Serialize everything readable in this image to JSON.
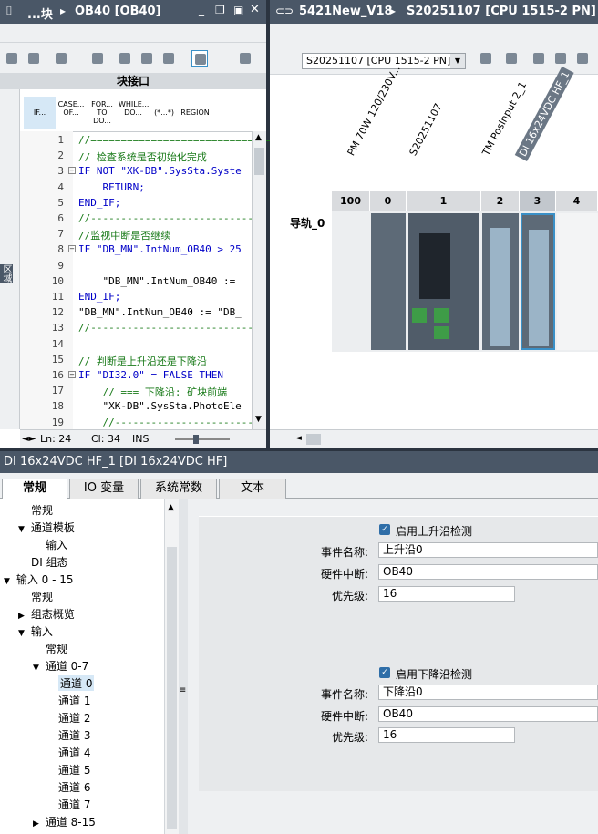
{
  "left_title": "...块",
  "left_breadcrumb": "OB40 [OB40]",
  "right_breadcrumb_project": "5421New_V18",
  "right_breadcrumb_device": "S20251107 [CPU 1515-2 PN]",
  "block_interface": "块接口",
  "instr_tabs": [
    "IF...",
    "CASE... OF...",
    "FOR... TO DO...",
    "WHILE... DO...",
    "(*...*)",
    "REGION"
  ],
  "code_lines": [
    {
      "n": "1",
      "t": "//=================================",
      "c": "cm"
    },
    {
      "n": "2",
      "t": "// 检查系统是否初始化完成",
      "c": "cm"
    },
    {
      "n": "3",
      "t": "IF NOT \"XK-DB\".SysSta.Syste",
      "c": "kw"
    },
    {
      "n": "4",
      "t": "    RETURN;",
      "c": "kw"
    },
    {
      "n": "5",
      "t": "END_IF;",
      "c": "kw"
    },
    {
      "n": "6",
      "t": "//---------------------------",
      "c": "cm"
    },
    {
      "n": "7",
      "t": "//监视中断是否继续",
      "c": "cm"
    },
    {
      "n": "8",
      "t": "IF \"DB_MN\".IntNum_OB40 > 25",
      "c": "kw"
    },
    {
      "n": "9",
      "t": "",
      "c": "str"
    },
    {
      "n": "10",
      "t": "    \"DB_MN\".IntNum_OB40 :=",
      "c": "str"
    },
    {
      "n": "11",
      "t": "END_IF;",
      "c": "kw"
    },
    {
      "n": "12",
      "t": "\"DB_MN\".IntNum_OB40 := \"DB_",
      "c": "str"
    },
    {
      "n": "13",
      "t": "//---------------------------",
      "c": "cm"
    },
    {
      "n": "14",
      "t": "",
      "c": "str"
    },
    {
      "n": "15",
      "t": "// 判断是上升沿还是下降沿",
      "c": "cm"
    },
    {
      "n": "16",
      "t": "IF \"DI32.0\" = FALSE THEN",
      "c": "kw"
    },
    {
      "n": "17",
      "t": "    // === 下降沿: 矿块前端",
      "c": "cm"
    },
    {
      "n": "18",
      "t": "    \"XK-DB\".SysSta.PhotoEle",
      "c": "str"
    },
    {
      "n": "19",
      "t": "    //-----------------------",
      "c": "cm"
    }
  ],
  "status": {
    "ln": "Ln: 24",
    "cl": "Cl: 34",
    "mode": "INS"
  },
  "device_select": "S20251107 [CPU 1515-2 PN]",
  "module_labels": [
    "PM 70W 120/230V...",
    "S20251107",
    "TM PosInput 2_1",
    "DI 16x24VDC HF_1"
  ],
  "rail_label": "导轨_0",
  "slots": [
    "100",
    "0",
    "1",
    "2",
    "3",
    "4"
  ],
  "props_title": "DI 16x24VDC HF_1 [DI 16x24VDC HF]",
  "props_tabs": [
    "常规",
    "IO 变量",
    "系统常数",
    "文本"
  ],
  "tree": [
    {
      "label": "常规",
      "indent": 0,
      "arrow": ""
    },
    {
      "label": "通道模板",
      "indent": 0,
      "arrow": "▼"
    },
    {
      "label": "输入",
      "indent": 2,
      "arrow": ""
    },
    {
      "label": "DI 组态",
      "indent": 0,
      "arrow": ""
    },
    {
      "label": "输入 0 - 15",
      "indent": -1,
      "arrow": "▼"
    },
    {
      "label": "常规",
      "indent": 0,
      "arrow": ""
    },
    {
      "label": "组态概览",
      "indent": 0,
      "arrow": "▶"
    },
    {
      "label": "输入",
      "indent": 0,
      "arrow": "▼"
    },
    {
      "label": "常规",
      "indent": 1,
      "arrow": ""
    },
    {
      "label": "通道 0-7",
      "indent": 1,
      "arrow": "▼"
    },
    {
      "label": "通道 0",
      "indent": 2,
      "arrow": ""
    },
    {
      "label": "通道 1",
      "indent": 2,
      "arrow": ""
    },
    {
      "label": "通道 2",
      "indent": 2,
      "arrow": ""
    },
    {
      "label": "通道 3",
      "indent": 2,
      "arrow": ""
    },
    {
      "label": "通道 4",
      "indent": 2,
      "arrow": ""
    },
    {
      "label": "通道 5",
      "indent": 2,
      "arrow": ""
    },
    {
      "label": "通道 6",
      "indent": 2,
      "arrow": ""
    },
    {
      "label": "通道 7",
      "indent": 2,
      "arrow": ""
    },
    {
      "label": "通道 8-15",
      "indent": 1,
      "arrow": "▶"
    }
  ],
  "rising": {
    "checkbox": "启用上升沿检测",
    "event_label": "事件名称:",
    "event": "上升沿0",
    "hw_label": "硬件中断:",
    "hw": "OB40",
    "prio_label": "优先级:",
    "prio": "16"
  },
  "falling": {
    "checkbox": "启用下降沿检测",
    "event_label": "事件名称:",
    "event": "下降沿0",
    "hw_label": "硬件中断:",
    "hw": "OB40",
    "prio_label": "优先级:",
    "prio": "16"
  },
  "side_label": "区域",
  "colors": {
    "header": "#4a5767",
    "accent": "#3a90c7",
    "tree_sel": "#d6e8f6"
  }
}
